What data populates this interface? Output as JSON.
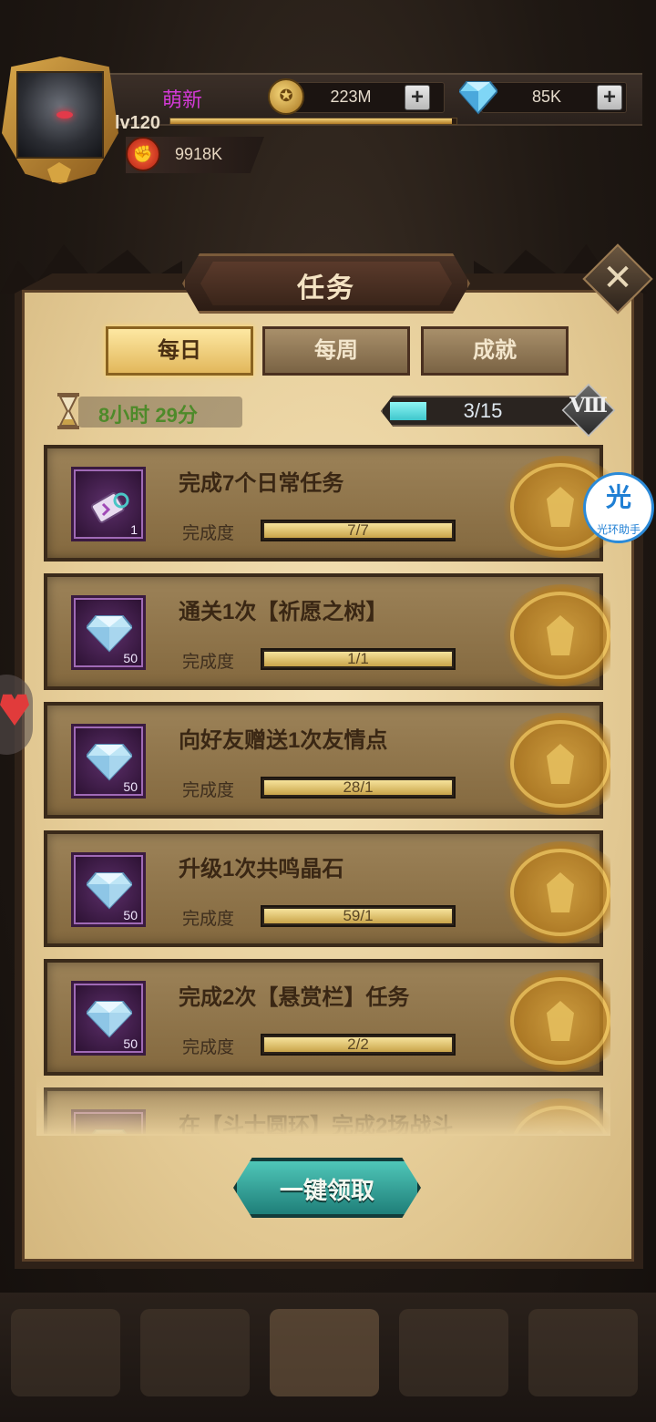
{
  "player": {
    "name": "萌新",
    "level": "lv120",
    "xp_fraction": 0.99,
    "power": "9918K",
    "power_icon": "fist-icon"
  },
  "resources": {
    "coins": "223M",
    "gems": "85K",
    "plus": "+"
  },
  "panel": {
    "title": "任务",
    "close_glyph": "✕"
  },
  "tabs": [
    {
      "label": "每日",
      "active": true
    },
    {
      "label": "每周",
      "active": false
    },
    {
      "label": "成就",
      "active": false
    }
  ],
  "timer": {
    "text": "8小时 29分"
  },
  "tier_progress": {
    "text": "3/15",
    "current": 3,
    "max": 15,
    "rank": "Ⅷ"
  },
  "tasks": [
    {
      "title": "完成7个日常任务",
      "progress_label": "完成度",
      "progress_text": "7/7",
      "fraction": 1.0,
      "reward_icon": "scroll-icon",
      "reward_qty": "1"
    },
    {
      "title": "通关1次【祈愿之树】",
      "progress_label": "完成度",
      "progress_text": "1/1",
      "fraction": 1.0,
      "reward_icon": "diamond-icon",
      "reward_qty": "50"
    },
    {
      "title": "向好友赠送1次友情点",
      "progress_label": "完成度",
      "progress_text": "28/1",
      "fraction": 1.0,
      "reward_icon": "diamond-icon",
      "reward_qty": "50"
    },
    {
      "title": "升级1次共鸣晶石",
      "progress_label": "完成度",
      "progress_text": "59/1",
      "fraction": 1.0,
      "reward_icon": "diamond-icon",
      "reward_qty": "50"
    },
    {
      "title": "完成2次【悬赏栏】任务",
      "progress_label": "完成度",
      "progress_text": "2/2",
      "fraction": 1.0,
      "reward_icon": "diamond-icon",
      "reward_qty": "50"
    },
    {
      "title": "在【斗士圆环】完成2场战斗",
      "progress_label": "完成度",
      "progress_text": "",
      "fraction": 1.0,
      "reward_icon": "diamond-icon",
      "reward_qty": ""
    }
  ],
  "claim_all": {
    "label": "一键领取"
  },
  "helper": {
    "top": "光",
    "bottom": "光环助手"
  },
  "colors": {
    "accent_gold": "#e2b85c",
    "claim_teal": "#1f7f79",
    "timer_green": "#4e8a2a",
    "tier_cyan": "#3ec6cc"
  }
}
